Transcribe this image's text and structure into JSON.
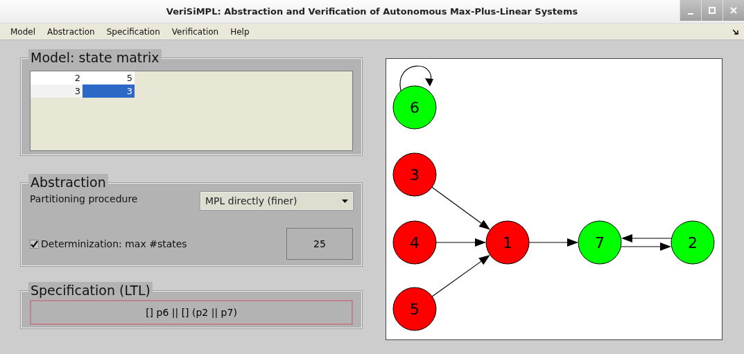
{
  "window": {
    "title": "VeriSiMPL: Abstraction and Verification of Autonomous Max-Plus-Linear Systems"
  },
  "menu": [
    "Model",
    "Abstraction",
    "Specification",
    "Verification",
    "Help"
  ],
  "model": {
    "title": "Model: state matrix",
    "rows": [
      [
        {
          "value": "2",
          "selected": false
        },
        {
          "value": "5",
          "selected": false
        }
      ],
      [
        {
          "value": "3",
          "selected": false
        },
        {
          "value": "3",
          "selected": true
        }
      ]
    ]
  },
  "abstraction": {
    "title": "Abstraction",
    "partitioning_label": "Partitioning procedure",
    "partitioning_value": "MPL directly (finer)",
    "determinization": {
      "label": "Determinization: max #states",
      "checked": true,
      "value": "25"
    }
  },
  "specification": {
    "title": "Specification (LTL)",
    "value": "[] p6 || [] (p2 || p7)"
  },
  "graph": {
    "nodes": [
      {
        "label": "6",
        "color": "#00ff00"
      },
      {
        "label": "3",
        "color": "#ff0000"
      },
      {
        "label": "4",
        "color": "#ff0000"
      },
      {
        "label": "5",
        "color": "#ff0000"
      },
      {
        "label": "1",
        "color": "#ff0000"
      },
      {
        "label": "7",
        "color": "#00ff00"
      },
      {
        "label": "2",
        "color": "#00ff00"
      }
    ]
  }
}
